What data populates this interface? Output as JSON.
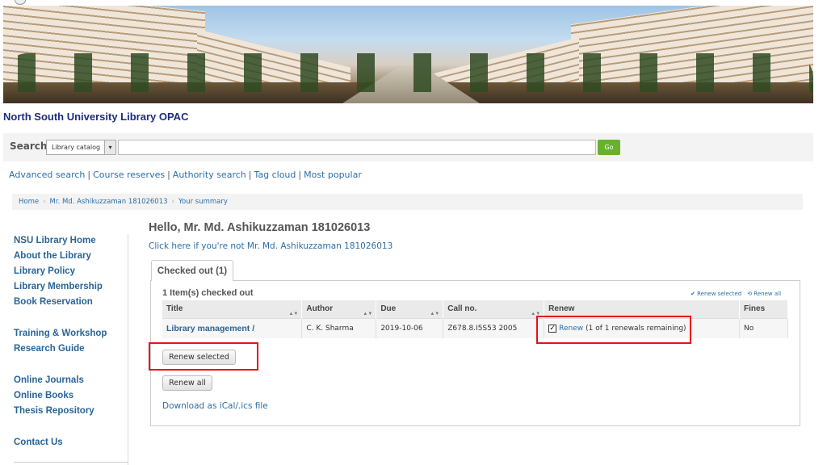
{
  "site": {
    "title": "North South University Library OPAC"
  },
  "search": {
    "label": "Search",
    "scope": "Library catalog",
    "query": "",
    "go_label": "Go"
  },
  "quicklinks": [
    "Advanced search",
    "Course reserves",
    "Authority search",
    "Tag cloud",
    "Most popular"
  ],
  "breadcrumb": [
    "Home",
    "Mr. Md. Ashikuzzaman 181026013",
    "Your summary"
  ],
  "sidebar": {
    "group1": [
      "NSU Library Home",
      "About the Library",
      "Library Policy",
      "Library Membership",
      "Book Reservation"
    ],
    "group2": [
      "Training & Workshop",
      "Research Guide"
    ],
    "group3": [
      "Online Journals",
      "Online Books",
      "Thesis Repository"
    ],
    "group4": [
      "Contact Us"
    ]
  },
  "main": {
    "greeting": "Hello, Mr. Md. Ashikuzzaman 181026013",
    "not_you": "Click here if you're not Mr. Md. Ashikuzzaman 181026013",
    "tab_label": "Checked out (1)",
    "items_count": "1 Item(s) checked out",
    "renew_selected_link": "✔ Renew selected",
    "renew_all_link": "⟲ Renew all",
    "columns": [
      "Title",
      "Author",
      "Due",
      "Call no.",
      "Renew",
      "Fines"
    ],
    "rows": [
      {
        "title": "Library management /",
        "author": "C. K. Sharma",
        "due": "2019-10-06",
        "call_no": "Z678.8.I5S53 2005",
        "renew_checked": true,
        "renew_link": "Renew",
        "renew_info": "(1 of 1 renewals remaining)",
        "fines": "No"
      }
    ],
    "renew_selected_button": "Renew selected",
    "renew_all_button": "Renew all",
    "ical_link": "Download as iCal/.ics file"
  },
  "colors": {
    "link": "#2c6ea6",
    "title_navy": "#1f2d7a",
    "go_green": "#69b12d",
    "highlight_red": "#e8101a"
  }
}
